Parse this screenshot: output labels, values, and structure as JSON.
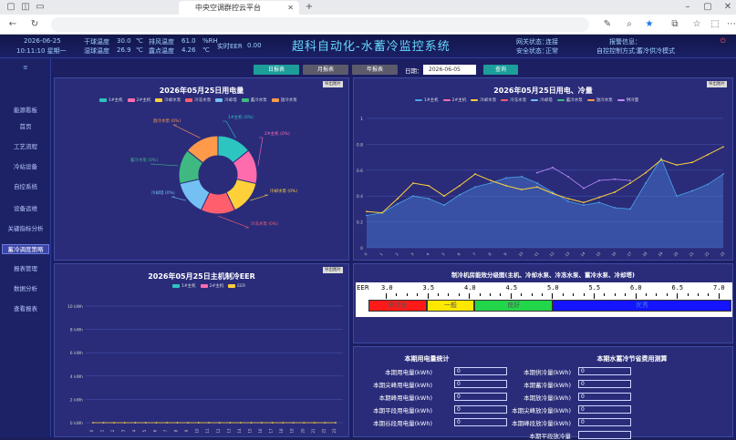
{
  "browser": {
    "tab_title": "中央空调群控云平台",
    "url": ""
  },
  "header": {
    "date": "2026-06-25",
    "time": "10:11:10 星期一",
    "dry_temp_label": "干球温度",
    "dry_temp": "30.0",
    "temp_unit": "℃",
    "wet_temp_label": "湿球温度",
    "wet_temp": "26.9",
    "exhaust_temp_label": "排风温度",
    "exhaust_temp": "61.0",
    "unit_rh": "%RH",
    "dew_label": "露点温度",
    "dew": "4.26",
    "dew_unit": "℃",
    "eer_label": "实时EER",
    "eer": "0.00",
    "title": "超科自动化-水蓄冷监控系统",
    "network_label": "网关状态：",
    "network": "连接",
    "safety_label": "安全状态：",
    "safety": "正常",
    "alarm_label": "报警信息：",
    "mode_label": "自控控制方式：",
    "mode": "蓄冷供冷模式"
  },
  "sidebar": {
    "items": [
      "能源看板",
      "首页",
      "工艺流程",
      "冷站设备",
      "自控系统",
      "设备运维",
      "关键指标分析",
      "蓄冷调度策略",
      "报表管理",
      "数据分析",
      "查看报表"
    ],
    "active_index": 7
  },
  "toolbar": {
    "daily": "日报表",
    "monthly": "月报表",
    "yearly": "年报表",
    "date_label": "日期：",
    "date": "2026-06-05",
    "query": "查询"
  },
  "pie_panel": {
    "title": "2026年05月25日用电量",
    "export": "导出图片",
    "legend": [
      {
        "name": "1#主机",
        "color": "#2cc5c0"
      },
      {
        "name": "2#主机",
        "color": "#ff6cae"
      },
      {
        "name": "冷却水泵",
        "color": "#ffd03a"
      },
      {
        "name": "冷冻水泵",
        "color": "#ff5f6d"
      },
      {
        "name": "冷却塔",
        "color": "#74c0f5"
      },
      {
        "name": "蓄冷水泵",
        "color": "#3fb981"
      },
      {
        "name": "放冷水泵",
        "color": "#ff9a4a"
      }
    ],
    "labels": [
      "1#主机 (0%)",
      "2#主机 (0%)",
      "冷却水泵 (0%)",
      "冷冻水泵 (0%)",
      "冷却塔 (0%)",
      "蓄冷水泵 (0%)",
      "放冷水泵 (0%)"
    ]
  },
  "line_panel": {
    "title": "2026年05月25日用电、冷量",
    "export": "导出图片",
    "legend": [
      {
        "name": "1#主机",
        "color": "#4aa3e6"
      },
      {
        "name": "2#主机",
        "color": "#ff6cae"
      },
      {
        "name": "冷却水泵",
        "color": "#ffd03a"
      },
      {
        "name": "冷冻水泵",
        "color": "#ff5f6d"
      },
      {
        "name": "冷却塔",
        "color": "#74c0f5"
      },
      {
        "name": "蓄冷水泵",
        "color": "#3fb981"
      },
      {
        "name": "放冷水泵",
        "color": "#ff9a4a"
      },
      {
        "name": "供冷量",
        "color": "#c38cff"
      }
    ],
    "yticks": [
      "1",
      "0.8",
      "0.6",
      "0.4",
      "0.2",
      "0"
    ]
  },
  "eer_panel": {
    "title": "2026年05月25日主机制冷EER",
    "export": "导出图片",
    "legend": [
      {
        "name": "1#主机",
        "color": "#2cc5c0"
      },
      {
        "name": "2#主机",
        "color": "#ff6cae"
      },
      {
        "name": "EER",
        "color": "#ffd03a"
      }
    ],
    "yticks": [
      "10 kWh",
      "8 kWh",
      "6 kWh",
      "4 kWh",
      "2 kWh",
      "0 kWh"
    ]
  },
  "scale_panel": {
    "title": "制冷机房能效分级图(主机、冷却水泵、冷冻水泵、蓄冷水泵、冷却塔)",
    "eer_label": "EER",
    "ticks": [
      "3.0",
      "3.5",
      "4.0",
      "4.5",
      "5.0",
      "5.5",
      "6.0",
      "6.5",
      "7.0"
    ],
    "bands": [
      {
        "label": "需改善",
        "color": "#ff1a1a"
      },
      {
        "label": "一般",
        "color": "#ffe800"
      },
      {
        "label": "良好",
        "color": "#22d64a"
      },
      {
        "label": "优秀",
        "color": "#1414ff"
      }
    ]
  },
  "stats_left": {
    "title": "本期用电量统计",
    "rows": [
      {
        "label": "本期用电量(kWh)",
        "value": "0"
      },
      {
        "label": "本期尖峰用电量(kWh)",
        "value": "0"
      },
      {
        "label": "本期峰用电量(kWh)",
        "value": "0"
      },
      {
        "label": "本期平段用电量(kWh)",
        "value": "0"
      },
      {
        "label": "本期谷段用电量(kWh)",
        "value": "0"
      }
    ]
  },
  "stats_right": {
    "title": "本期水蓄冷节省费用测算",
    "rows": [
      {
        "label": "本期供冷量(kWh)",
        "value": "0"
      },
      {
        "label": "本期蓄冷量(kWh)",
        "value": "0"
      },
      {
        "label": "本期放冷量(kWh)",
        "value": "0"
      },
      {
        "label": "本期尖峰放冷量(kWh)",
        "value": "0"
      },
      {
        "label": "本期峰段放冷量(kWh)",
        "value": "0"
      },
      {
        "label": "本期平段放冷量",
        "value": ""
      }
    ]
  },
  "chart_data": [
    {
      "type": "pie",
      "title": "2026年05月25日用电量",
      "categories": [
        "1#主机",
        "2#主机",
        "冷却水泵",
        "冷冻水泵",
        "冷却塔",
        "蓄冷水泵",
        "放冷水泵"
      ],
      "values": [
        1,
        1,
        1,
        1,
        1,
        1,
        1
      ]
    },
    {
      "type": "line",
      "title": "2026年05月25日用电、冷量",
      "ylim": [
        0,
        1
      ],
      "x": [
        "0",
        "1",
        "2",
        "3",
        "4",
        "5",
        "6",
        "7",
        "8",
        "9",
        "10",
        "11",
        "12",
        "13",
        "14",
        "15",
        "16",
        "17",
        "18",
        "19",
        "20",
        "21",
        "22",
        "23"
      ],
      "series": [
        {
          "name": "1#主机",
          "values": [
            0.25,
            0.27,
            0.34,
            0.4,
            0.38,
            0.33,
            0.41,
            0.47,
            0.5,
            0.54,
            0.55,
            0.5,
            0.43,
            0.36,
            0.33,
            0.35,
            0.31,
            0.3,
            0.5,
            0.69,
            0.4,
            0.44,
            0.49,
            0.57
          ]
        },
        {
          "name": "冷却水泵",
          "values": [
            0.28,
            0.27,
            0.38,
            0.5,
            0.48,
            0.4,
            0.48,
            0.57,
            0.52,
            0.48,
            0.45,
            0.47,
            0.42,
            0.38,
            0.35,
            0.39,
            0.43,
            0.5,
            0.58,
            0.68,
            0.64,
            0.66,
            0.72,
            0.78
          ]
        },
        {
          "name": "供冷量",
          "values": [
            null,
            null,
            null,
            null,
            null,
            null,
            null,
            null,
            null,
            null,
            null,
            0.58,
            0.62,
            0.55,
            0.46,
            0.52,
            0.53,
            0.52,
            null,
            null,
            null,
            null,
            null,
            null
          ]
        }
      ]
    },
    {
      "type": "line",
      "title": "2026年05月25日主机制冷EER",
      "ylim": [
        0,
        10
      ],
      "x": [
        "0",
        "1",
        "2",
        "3",
        "4",
        "5",
        "6",
        "7",
        "8",
        "9",
        "10",
        "11",
        "12",
        "13",
        "14",
        "15",
        "16",
        "17",
        "18",
        "19",
        "20",
        "21",
        "22",
        "23"
      ],
      "series": [
        {
          "name": "EER",
          "values": [
            0,
            0,
            0,
            0,
            0,
            0,
            0,
            0,
            0,
            0,
            0,
            0,
            0,
            0,
            0,
            0,
            0,
            0,
            0,
            0,
            0,
            0,
            0,
            0
          ]
        }
      ]
    }
  ]
}
